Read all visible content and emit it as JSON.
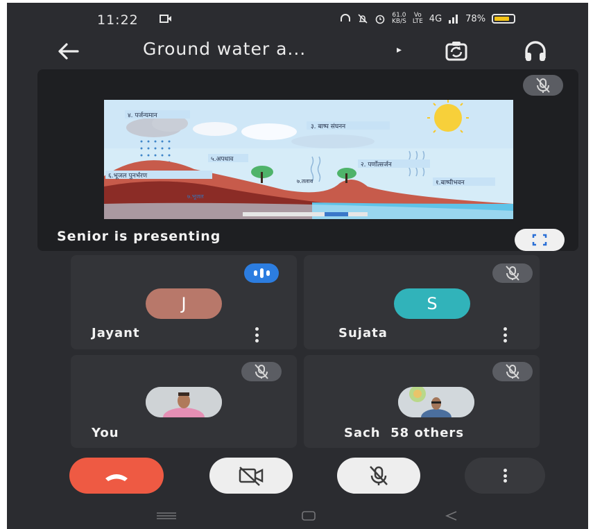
{
  "status_bar": {
    "time": "11:22",
    "speed_value": "61.0",
    "speed_unit": "KB/S",
    "net_type": "4G",
    "battery": "78%"
  },
  "top_bar": {
    "title": "Ground water a...",
    "title_arrow": "▸"
  },
  "presentation": {
    "label": "Senior is presenting",
    "slide_labels": {
      "precipitation": "४. पर्जन्यमान",
      "condensation": "३. बाष्प संघनन",
      "runoff": "५.अपधाव",
      "transpiration": "२. पर्णोत्सर्जन",
      "infiltration": "६.भूजल पुनर्भरण",
      "lake": "७.तलाव",
      "evaporation": "१.बाष्पीभवन",
      "groundwater": "७.भूजल"
    }
  },
  "participants": [
    {
      "name": "Jayant",
      "initial": "J",
      "avatar_color": "#b8786a",
      "speaking": true
    },
    {
      "name": "Sujata",
      "initial": "S",
      "avatar_color": "#31b3ba",
      "muted": true
    },
    {
      "name": "You",
      "muted": true
    },
    {
      "name": "Sach  58 others",
      "muted": true
    }
  ],
  "colors": {
    "end_call": "#ee5a43",
    "speaking_indicator": "#2c7de0",
    "background": "#2b2c30"
  }
}
